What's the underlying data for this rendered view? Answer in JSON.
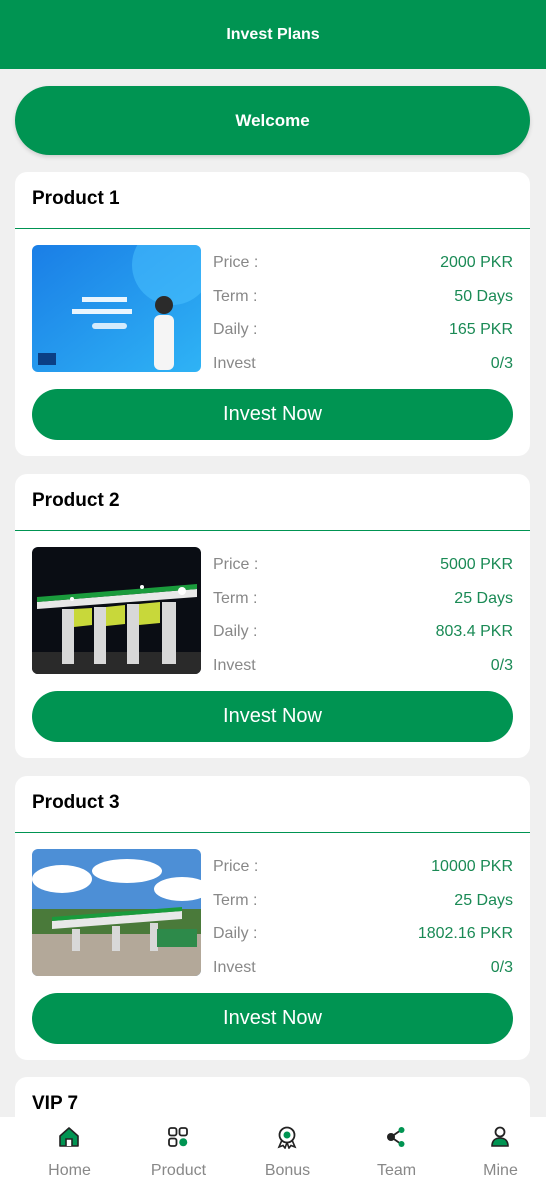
{
  "header": {
    "title": "Invest Plans"
  },
  "welcome": {
    "label": "Welcome"
  },
  "products": [
    {
      "title": "Product 1",
      "rows": [
        {
          "label": "Price :",
          "value": "2000 PKR"
        },
        {
          "label": "Term :",
          "value": "50 Days"
        },
        {
          "label": "Daily :",
          "value": "165 PKR"
        },
        {
          "label": "Invest",
          "value": "0/3"
        }
      ],
      "button": "Invest Now"
    },
    {
      "title": "Product 2",
      "rows": [
        {
          "label": "Price :",
          "value": "5000 PKR"
        },
        {
          "label": "Term :",
          "value": "25 Days"
        },
        {
          "label": "Daily :",
          "value": "803.4 PKR"
        },
        {
          "label": "Invest",
          "value": "0/3"
        }
      ],
      "button": "Invest Now"
    },
    {
      "title": "Product 3",
      "rows": [
        {
          "label": "Price :",
          "value": "10000 PKR"
        },
        {
          "label": "Term :",
          "value": "25 Days"
        },
        {
          "label": "Daily :",
          "value": "1802.16 PKR"
        },
        {
          "label": "Invest",
          "value": "0/3"
        }
      ],
      "button": "Invest Now"
    }
  ],
  "partial_card": {
    "title": "VIP 7"
  },
  "tabbar": {
    "items": [
      {
        "label": "Home",
        "icon": "home-icon"
      },
      {
        "label": "Product",
        "icon": "grid-icon"
      },
      {
        "label": "Bonus",
        "icon": "award-icon"
      },
      {
        "label": "Team",
        "icon": "share-icon"
      },
      {
        "label": "Mine",
        "icon": "user-icon"
      }
    ]
  },
  "colors": {
    "primary": "#009452",
    "value_text": "#1a8a55",
    "label_text": "#888888"
  }
}
